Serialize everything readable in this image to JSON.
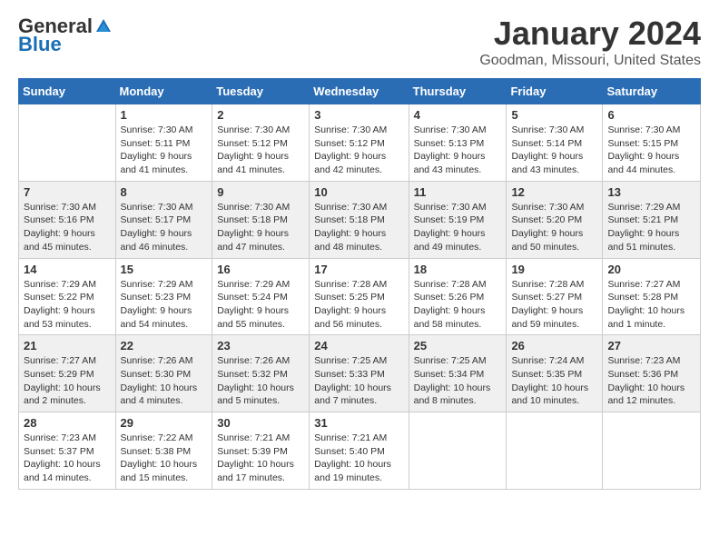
{
  "logo": {
    "general": "General",
    "blue": "Blue"
  },
  "header": {
    "month": "January 2024",
    "location": "Goodman, Missouri, United States"
  },
  "weekdays": [
    "Sunday",
    "Monday",
    "Tuesday",
    "Wednesday",
    "Thursday",
    "Friday",
    "Saturday"
  ],
  "weeks": [
    [
      {
        "day": "",
        "sunrise": "",
        "sunset": "",
        "daylight": ""
      },
      {
        "day": "1",
        "sunrise": "Sunrise: 7:30 AM",
        "sunset": "Sunset: 5:11 PM",
        "daylight": "Daylight: 9 hours and 41 minutes."
      },
      {
        "day": "2",
        "sunrise": "Sunrise: 7:30 AM",
        "sunset": "Sunset: 5:12 PM",
        "daylight": "Daylight: 9 hours and 41 minutes."
      },
      {
        "day": "3",
        "sunrise": "Sunrise: 7:30 AM",
        "sunset": "Sunset: 5:12 PM",
        "daylight": "Daylight: 9 hours and 42 minutes."
      },
      {
        "day": "4",
        "sunrise": "Sunrise: 7:30 AM",
        "sunset": "Sunset: 5:13 PM",
        "daylight": "Daylight: 9 hours and 43 minutes."
      },
      {
        "day": "5",
        "sunrise": "Sunrise: 7:30 AM",
        "sunset": "Sunset: 5:14 PM",
        "daylight": "Daylight: 9 hours and 43 minutes."
      },
      {
        "day": "6",
        "sunrise": "Sunrise: 7:30 AM",
        "sunset": "Sunset: 5:15 PM",
        "daylight": "Daylight: 9 hours and 44 minutes."
      }
    ],
    [
      {
        "day": "7",
        "sunrise": "Sunrise: 7:30 AM",
        "sunset": "Sunset: 5:16 PM",
        "daylight": "Daylight: 9 hours and 45 minutes."
      },
      {
        "day": "8",
        "sunrise": "Sunrise: 7:30 AM",
        "sunset": "Sunset: 5:17 PM",
        "daylight": "Daylight: 9 hours and 46 minutes."
      },
      {
        "day": "9",
        "sunrise": "Sunrise: 7:30 AM",
        "sunset": "Sunset: 5:18 PM",
        "daylight": "Daylight: 9 hours and 47 minutes."
      },
      {
        "day": "10",
        "sunrise": "Sunrise: 7:30 AM",
        "sunset": "Sunset: 5:18 PM",
        "daylight": "Daylight: 9 hours and 48 minutes."
      },
      {
        "day": "11",
        "sunrise": "Sunrise: 7:30 AM",
        "sunset": "Sunset: 5:19 PM",
        "daylight": "Daylight: 9 hours and 49 minutes."
      },
      {
        "day": "12",
        "sunrise": "Sunrise: 7:30 AM",
        "sunset": "Sunset: 5:20 PM",
        "daylight": "Daylight: 9 hours and 50 minutes."
      },
      {
        "day": "13",
        "sunrise": "Sunrise: 7:29 AM",
        "sunset": "Sunset: 5:21 PM",
        "daylight": "Daylight: 9 hours and 51 minutes."
      }
    ],
    [
      {
        "day": "14",
        "sunrise": "Sunrise: 7:29 AM",
        "sunset": "Sunset: 5:22 PM",
        "daylight": "Daylight: 9 hours and 53 minutes."
      },
      {
        "day": "15",
        "sunrise": "Sunrise: 7:29 AM",
        "sunset": "Sunset: 5:23 PM",
        "daylight": "Daylight: 9 hours and 54 minutes."
      },
      {
        "day": "16",
        "sunrise": "Sunrise: 7:29 AM",
        "sunset": "Sunset: 5:24 PM",
        "daylight": "Daylight: 9 hours and 55 minutes."
      },
      {
        "day": "17",
        "sunrise": "Sunrise: 7:28 AM",
        "sunset": "Sunset: 5:25 PM",
        "daylight": "Daylight: 9 hours and 56 minutes."
      },
      {
        "day": "18",
        "sunrise": "Sunrise: 7:28 AM",
        "sunset": "Sunset: 5:26 PM",
        "daylight": "Daylight: 9 hours and 58 minutes."
      },
      {
        "day": "19",
        "sunrise": "Sunrise: 7:28 AM",
        "sunset": "Sunset: 5:27 PM",
        "daylight": "Daylight: 9 hours and 59 minutes."
      },
      {
        "day": "20",
        "sunrise": "Sunrise: 7:27 AM",
        "sunset": "Sunset: 5:28 PM",
        "daylight": "Daylight: 10 hours and 1 minute."
      }
    ],
    [
      {
        "day": "21",
        "sunrise": "Sunrise: 7:27 AM",
        "sunset": "Sunset: 5:29 PM",
        "daylight": "Daylight: 10 hours and 2 minutes."
      },
      {
        "day": "22",
        "sunrise": "Sunrise: 7:26 AM",
        "sunset": "Sunset: 5:30 PM",
        "daylight": "Daylight: 10 hours and 4 minutes."
      },
      {
        "day": "23",
        "sunrise": "Sunrise: 7:26 AM",
        "sunset": "Sunset: 5:32 PM",
        "daylight": "Daylight: 10 hours and 5 minutes."
      },
      {
        "day": "24",
        "sunrise": "Sunrise: 7:25 AM",
        "sunset": "Sunset: 5:33 PM",
        "daylight": "Daylight: 10 hours and 7 minutes."
      },
      {
        "day": "25",
        "sunrise": "Sunrise: 7:25 AM",
        "sunset": "Sunset: 5:34 PM",
        "daylight": "Daylight: 10 hours and 8 minutes."
      },
      {
        "day": "26",
        "sunrise": "Sunrise: 7:24 AM",
        "sunset": "Sunset: 5:35 PM",
        "daylight": "Daylight: 10 hours and 10 minutes."
      },
      {
        "day": "27",
        "sunrise": "Sunrise: 7:23 AM",
        "sunset": "Sunset: 5:36 PM",
        "daylight": "Daylight: 10 hours and 12 minutes."
      }
    ],
    [
      {
        "day": "28",
        "sunrise": "Sunrise: 7:23 AM",
        "sunset": "Sunset: 5:37 PM",
        "daylight": "Daylight: 10 hours and 14 minutes."
      },
      {
        "day": "29",
        "sunrise": "Sunrise: 7:22 AM",
        "sunset": "Sunset: 5:38 PM",
        "daylight": "Daylight: 10 hours and 15 minutes."
      },
      {
        "day": "30",
        "sunrise": "Sunrise: 7:21 AM",
        "sunset": "Sunset: 5:39 PM",
        "daylight": "Daylight: 10 hours and 17 minutes."
      },
      {
        "day": "31",
        "sunrise": "Sunrise: 7:21 AM",
        "sunset": "Sunset: 5:40 PM",
        "daylight": "Daylight: 10 hours and 19 minutes."
      },
      {
        "day": "",
        "sunrise": "",
        "sunset": "",
        "daylight": ""
      },
      {
        "day": "",
        "sunrise": "",
        "sunset": "",
        "daylight": ""
      },
      {
        "day": "",
        "sunrise": "",
        "sunset": "",
        "daylight": ""
      }
    ]
  ]
}
